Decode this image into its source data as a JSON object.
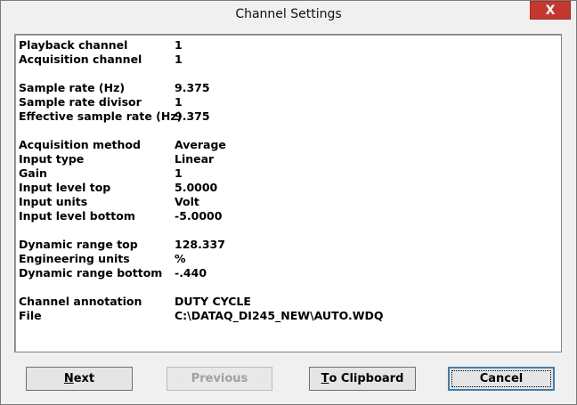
{
  "window": {
    "title": "Channel Settings",
    "close_glyph": "X"
  },
  "groups": [
    [
      {
        "label": "Playback channel",
        "value": "1"
      },
      {
        "label": "Acquisition channel",
        "value": "1"
      }
    ],
    [
      {
        "label": "Sample rate (Hz)",
        "value": "9.375"
      },
      {
        "label": "Sample rate divisor",
        "value": "1"
      },
      {
        "label": "Effective sample rate (Hz)",
        "value": "9.375"
      }
    ],
    [
      {
        "label": "Acquisition method",
        "value": "Average"
      },
      {
        "label": "Input type",
        "value": "Linear"
      },
      {
        "label": "Gain",
        "value": "1"
      },
      {
        "label": "Input level top",
        "value": "5.0000"
      },
      {
        "label": "Input units",
        "value": "Volt"
      },
      {
        "label": "Input level bottom",
        "value": "-5.0000"
      }
    ],
    [
      {
        "label": "Dynamic range top",
        "value": "128.337"
      },
      {
        "label": "Engineering units",
        "value": "%"
      },
      {
        "label": "Dynamic range bottom",
        "value": "-.440"
      }
    ],
    [
      {
        "label": "Channel annotation",
        "value": "DUTY CYCLE"
      },
      {
        "label": "File",
        "value": "C:\\DATAQ_DI245_NEW\\AUTO.WDQ"
      }
    ]
  ],
  "buttons": {
    "next": {
      "mnemonic": "N",
      "rest": "ext"
    },
    "previous": {
      "label": "Previous"
    },
    "clipboard": {
      "mnemonic": "T",
      "rest": "o Clipboard"
    },
    "cancel": {
      "label": "Cancel"
    }
  }
}
